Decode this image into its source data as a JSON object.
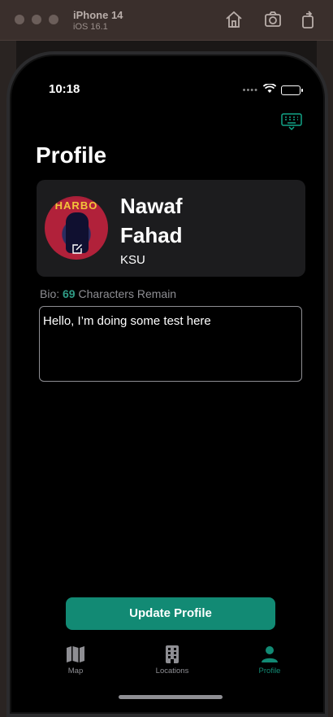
{
  "simulator": {
    "device": "iPhone 14",
    "os": "iOS 16.1",
    "icons": [
      "home-icon",
      "screenshot-icon",
      "rotate-icon"
    ]
  },
  "status_bar": {
    "time": "10:18"
  },
  "page": {
    "title": "Profile"
  },
  "profile": {
    "first_name": "Nawaf",
    "last_name": "Fahad",
    "organization": "KSU",
    "avatar_text": "HARBO"
  },
  "bio": {
    "label_prefix": "Bio:",
    "remaining_count": "69",
    "label_suffix": "Characters Remain",
    "value": "Hello, I’m doing some test here"
  },
  "actions": {
    "update_label": "Update Profile"
  },
  "tabs": [
    {
      "label": "Map",
      "icon": "map-icon",
      "active": false
    },
    {
      "label": "Locations",
      "icon": "building-icon",
      "active": false
    },
    {
      "label": "Profile",
      "icon": "person-icon",
      "active": true
    }
  ],
  "colors": {
    "accent": "#128a74",
    "accent_text": "#2f9c86",
    "inactive_tab": "#8e8e93",
    "card_bg": "#1c1c1e"
  }
}
